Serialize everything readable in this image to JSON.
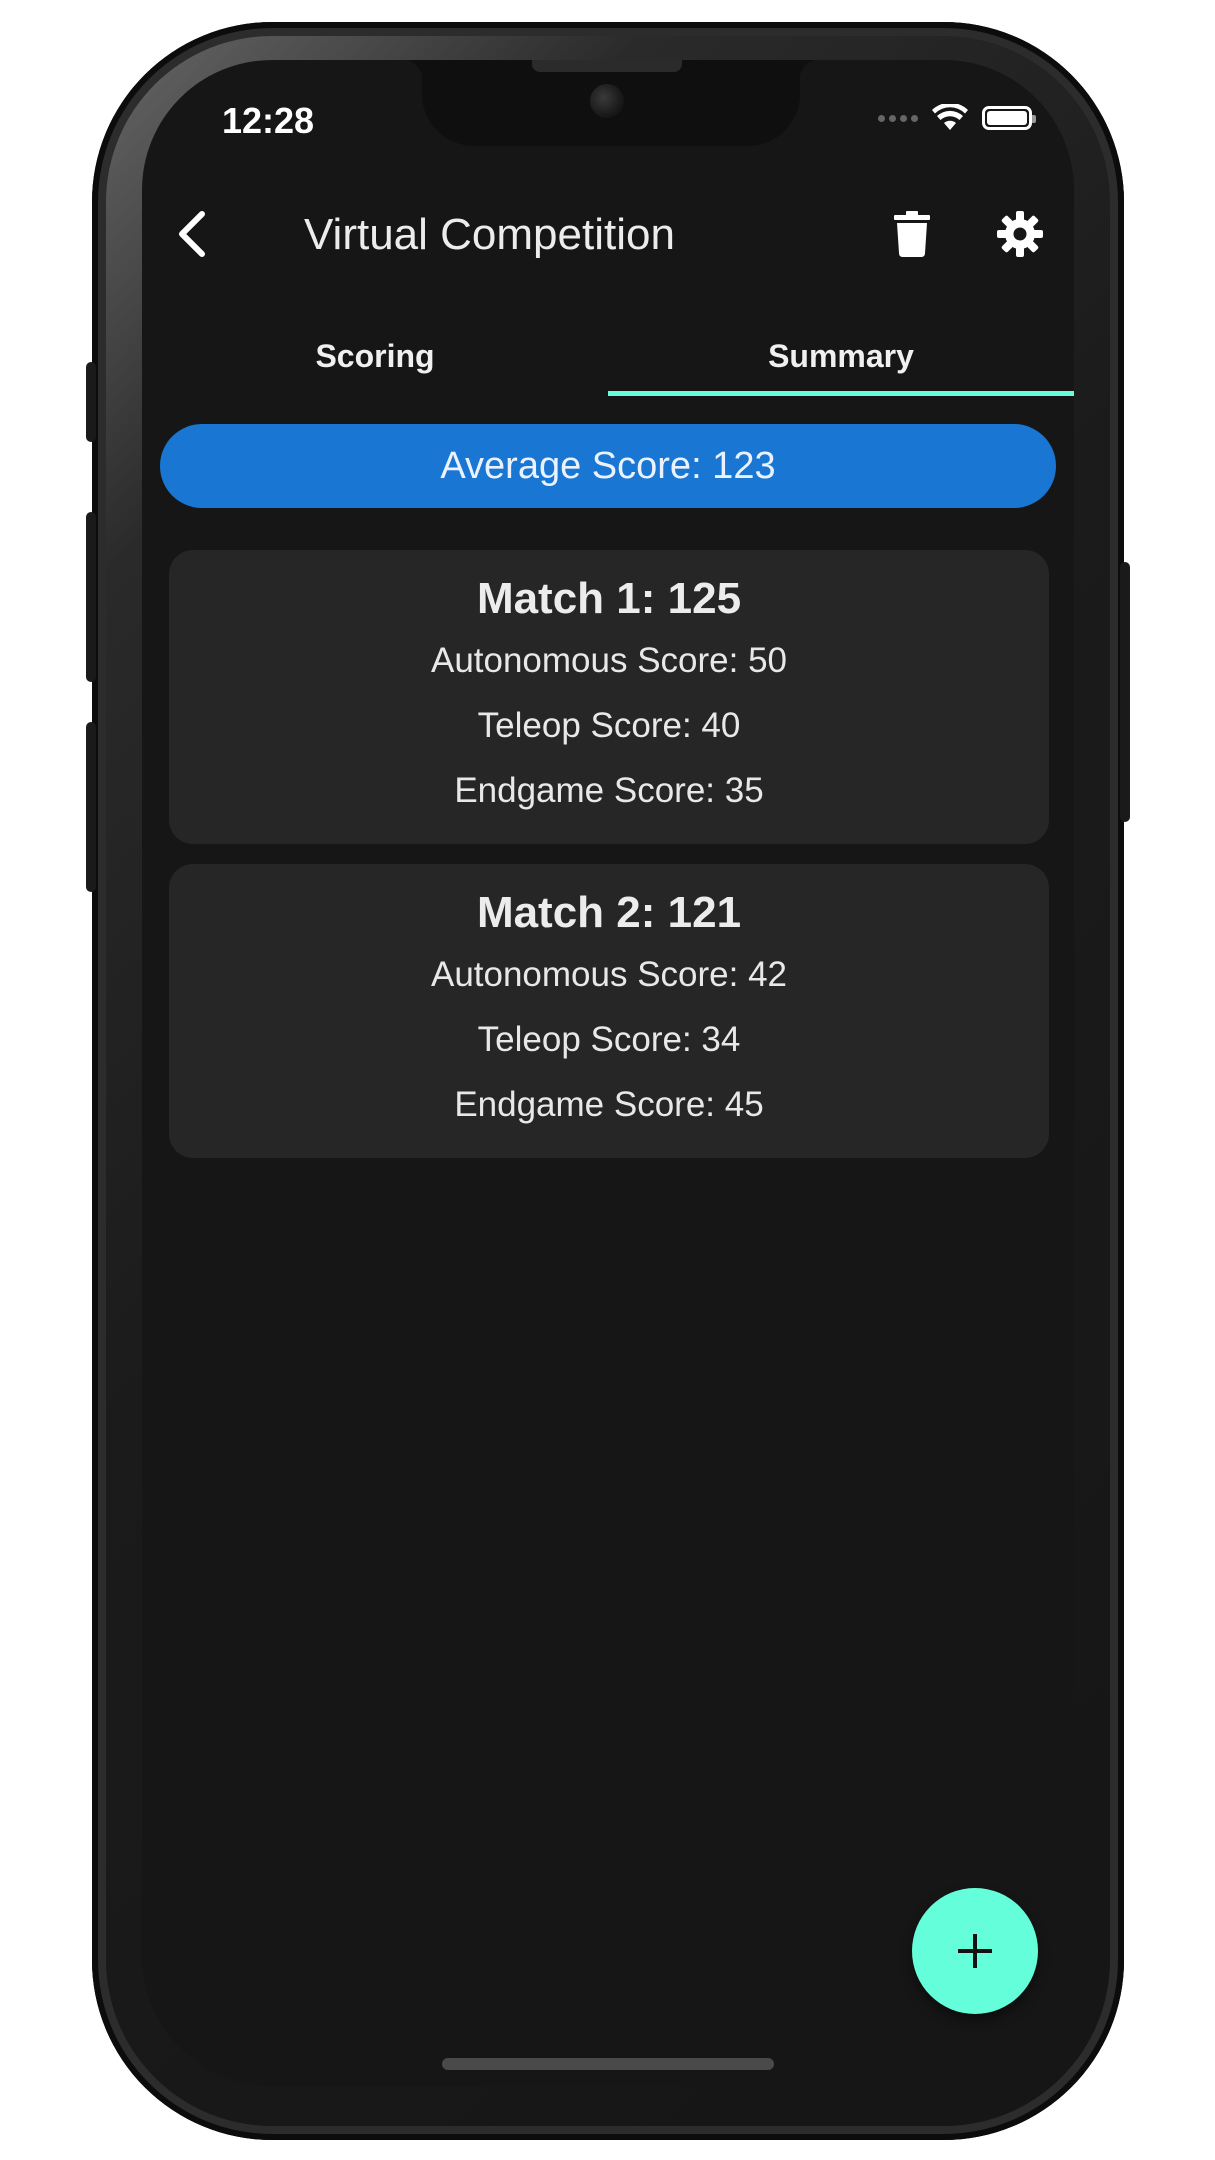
{
  "status": {
    "time": "12:28"
  },
  "appbar": {
    "title": "Virtual Competition",
    "back_icon": "chevron-left-icon",
    "delete_icon": "trash-icon",
    "settings_icon": "gear-icon"
  },
  "tabs": [
    {
      "label": "Scoring",
      "active": false
    },
    {
      "label": "Summary",
      "active": true
    }
  ],
  "summary": {
    "average_label": "Average Score: 123"
  },
  "matches": [
    {
      "heading": "Match 1: 125",
      "autonomous": "Autonomous Score: 50",
      "teleop": "Teleop Score: 40",
      "endgame": "Endgame Score: 35"
    },
    {
      "heading": "Match 2: 121",
      "autonomous": "Autonomous Score: 42",
      "teleop": "Teleop Score: 34",
      "endgame": "Endgame Score: 45"
    }
  ],
  "fab": {
    "icon": "plus-icon"
  },
  "colors": {
    "accent": "#64ffda",
    "primary": "#1976d2",
    "background": "#161616",
    "card": "#262626"
  }
}
